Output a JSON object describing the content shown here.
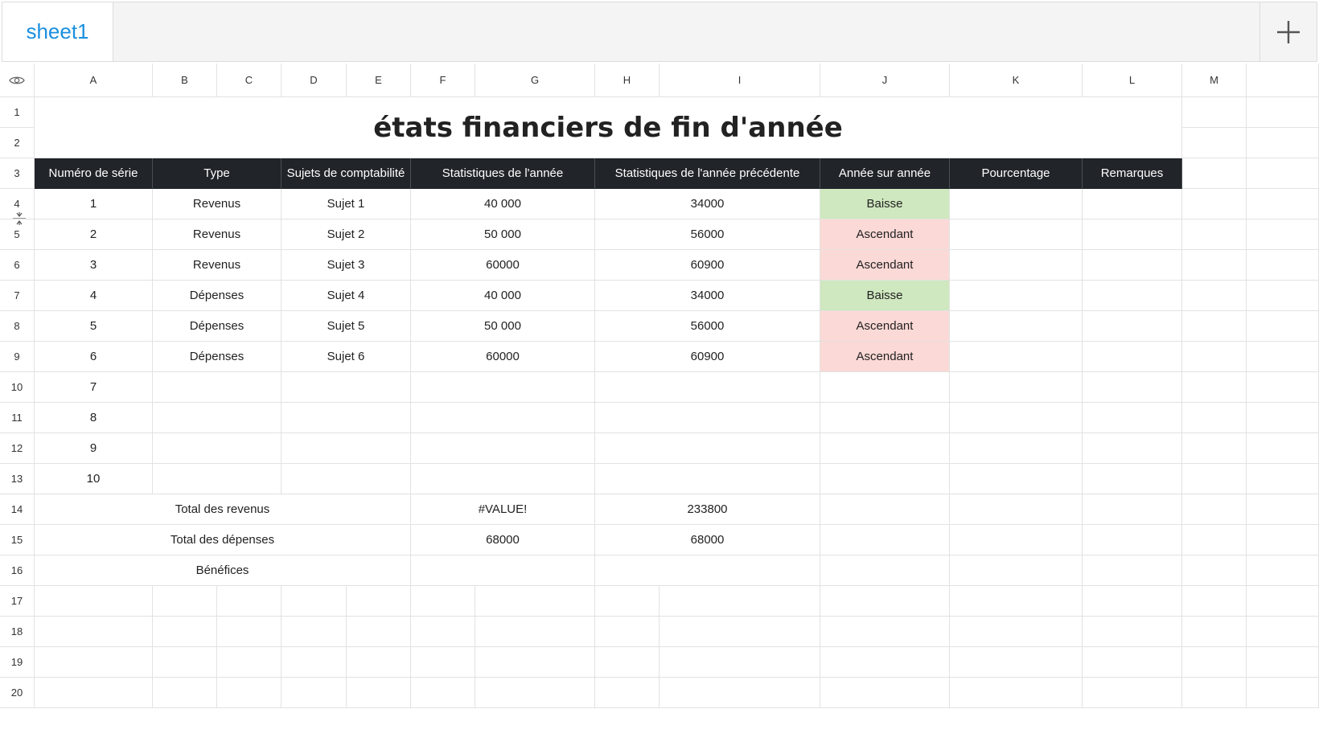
{
  "tabs": [
    {
      "label": "sheet1"
    }
  ],
  "columns": [
    "A",
    "B",
    "C",
    "D",
    "E",
    "F",
    "G",
    "H",
    "I",
    "J",
    "K",
    "L",
    "M"
  ],
  "rows": [
    "1",
    "2",
    "3",
    "4",
    "5",
    "6",
    "7",
    "8",
    "9",
    "10",
    "11",
    "12",
    "13",
    "14",
    "15",
    "16",
    "17",
    "18",
    "19",
    "20"
  ],
  "sheet": {
    "title": "états financiers de fin d'année",
    "headers": [
      "Numéro de série",
      "Type",
      "Sujets de comptabilité",
      "Statistiques de l'année",
      "Statistiques de l'année précédente",
      "Année sur année",
      "Pourcentage",
      "Remarques"
    ],
    "data_rows": [
      {
        "num": "1",
        "type": "Revenus",
        "sujet": "Sujet 1",
        "annee": "40 000",
        "precedente": "34000",
        "yoy": "Baisse",
        "status": "down"
      },
      {
        "num": "2",
        "type": "Revenus",
        "sujet": "Sujet 2",
        "annee": "50 000",
        "precedente": "56000",
        "yoy": "Ascendant",
        "status": "up"
      },
      {
        "num": "3",
        "type": "Revenus",
        "sujet": "Sujet 3",
        "annee": "60000",
        "precedente": "60900",
        "yoy": "Ascendant",
        "status": "up"
      },
      {
        "num": "4",
        "type": "Dépenses",
        "sujet": "Sujet 4",
        "annee": "40 000",
        "precedente": "34000",
        "yoy": "Baisse",
        "status": "down"
      },
      {
        "num": "5",
        "type": "Dépenses",
        "sujet": "Sujet 5",
        "annee": "50 000",
        "precedente": "56000",
        "yoy": "Ascendant",
        "status": "up"
      },
      {
        "num": "6",
        "type": "Dépenses",
        "sujet": "Sujet 6",
        "annee": "60000",
        "precedente": "60900",
        "yoy": "Ascendant",
        "status": "up"
      }
    ],
    "empty_numbers": [
      "7",
      "8",
      "9",
      "10"
    ],
    "totals": [
      {
        "label": "Total des revenus",
        "annee": "#VALUE!",
        "precedente": "233800"
      },
      {
        "label": "Total des dépenses",
        "annee": "68000",
        "precedente": "68000"
      },
      {
        "label": "Bénéfices",
        "annee": "",
        "precedente": ""
      }
    ]
  },
  "colors": {
    "header_bg": "#212529",
    "down_bg": "#cfe8bf",
    "up_bg": "#fbd9d6",
    "tab_text": "#1a8fe0"
  },
  "icons": {
    "corner": "eye-icon",
    "add": "plus-icon",
    "col_resize": "column-resize-icon",
    "row_resize": "row-resize-icon"
  }
}
